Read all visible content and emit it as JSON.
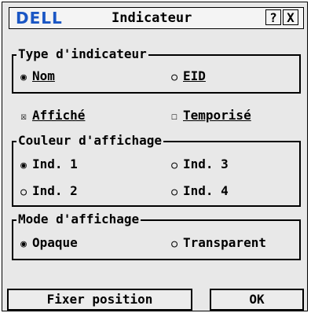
{
  "window": {
    "brand": "DELL",
    "title": "Indicateur",
    "help_button": "?",
    "close_button": "X"
  },
  "indicator_type": {
    "legend": "Type d'indicateur",
    "options": [
      {
        "label": "Nom",
        "selected": true
      },
      {
        "label": "EID",
        "selected": false
      }
    ]
  },
  "display_checkboxes": [
    {
      "label": "Affiché",
      "checked": true
    },
    {
      "label": "Temporisé",
      "checked": false
    }
  ],
  "display_color": {
    "legend": "Couleur d'affichage",
    "options": [
      {
        "label": "Ind. 1",
        "selected": true
      },
      {
        "label": "Ind. 3",
        "selected": false
      },
      {
        "label": "Ind. 2",
        "selected": false
      },
      {
        "label": "Ind. 4",
        "selected": false
      }
    ]
  },
  "display_mode": {
    "legend": "Mode d'affichage",
    "options": [
      {
        "label": "Opaque",
        "selected": true
      },
      {
        "label": "Transparent",
        "selected": false
      }
    ]
  },
  "buttons": {
    "set_position": "Fixer position",
    "ok": "OK"
  },
  "icons": {
    "radio_selected": "◉",
    "radio_empty": "○",
    "checkbox_checked": "☒",
    "checkbox_empty": "☐"
  },
  "colors": {
    "brand": "#1a56c4",
    "background": "#e8e8e8"
  }
}
